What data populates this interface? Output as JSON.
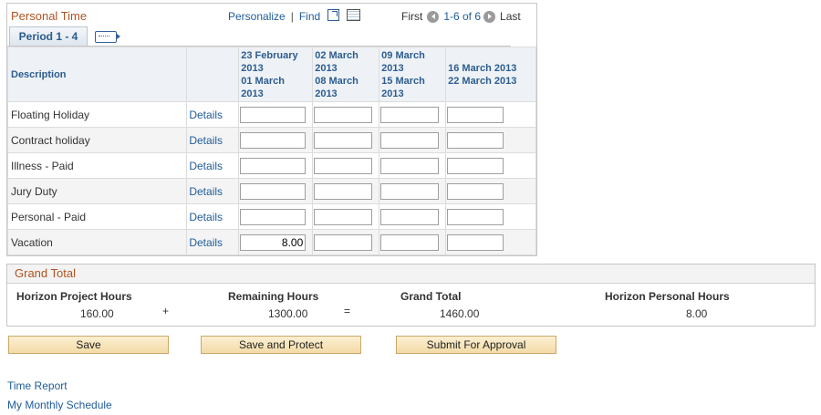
{
  "grid": {
    "title": "Personal Time",
    "personalize": "Personalize",
    "separator": "|",
    "find": "Find",
    "pager": {
      "first": "First",
      "range": "1-6 of 6",
      "last": "Last"
    },
    "tab_label": "Period 1 - 4",
    "columns": {
      "description": "Description",
      "p1_line1": "23 February",
      "p1_line2": "2013",
      "p1_line3": "01 March",
      "p1_line4": "2013",
      "p2_line1": "02 March",
      "p2_line2": "2013",
      "p2_line3": "08 March",
      "p2_line4": "2013",
      "p3_line1": "09 March",
      "p3_line2": "2013",
      "p3_line3": "15 March",
      "p3_line4": "2013",
      "p4_line1": "16 March 2013",
      "p4_line2": "22 March 2013"
    },
    "details_label": "Details",
    "rows": [
      {
        "description": "Floating Holiday",
        "values": [
          "",
          "",
          "",
          ""
        ]
      },
      {
        "description": "Contract holiday",
        "values": [
          "",
          "",
          "",
          ""
        ]
      },
      {
        "description": "Illness - Paid",
        "values": [
          "",
          "",
          "",
          ""
        ]
      },
      {
        "description": "Jury Duty",
        "values": [
          "",
          "",
          "",
          ""
        ]
      },
      {
        "description": "Personal - Paid",
        "values": [
          "",
          "",
          "",
          ""
        ]
      },
      {
        "description": "Vacation",
        "values": [
          "8.00",
          "",
          "",
          ""
        ]
      }
    ]
  },
  "grand_total": {
    "title": "Grand Total",
    "labels": {
      "project": "Horizon Project Hours",
      "remaining": "Remaining Hours",
      "total": "Grand Total",
      "personal": "Horizon Personal Hours"
    },
    "values": {
      "project": "160.00",
      "remaining": "1300.00",
      "total": "1460.00",
      "personal": "8.00"
    },
    "plus": "+",
    "equals": "="
  },
  "buttons": {
    "save": "Save",
    "save_protect": "Save and Protect",
    "submit": "Submit For Approval"
  },
  "links": {
    "time_report": "Time Report",
    "monthly_schedule": "My Monthly Schedule"
  }
}
